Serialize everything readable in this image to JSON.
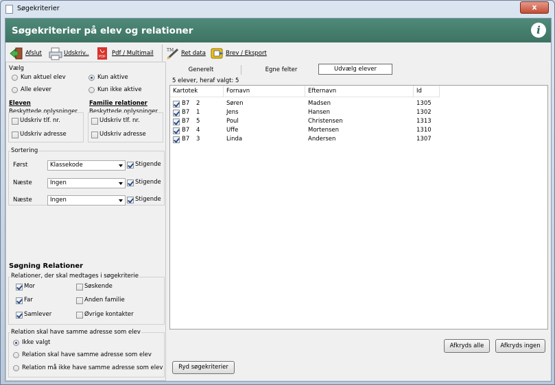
{
  "window": {
    "title": "Søgekriterier",
    "close_label": "x"
  },
  "header": {
    "title": "Søgekriterier på elev og relationer",
    "info_glyph": "i"
  },
  "toolbar": {
    "afslut": "Afslut",
    "udskriv": "Udskriv..",
    "pdf": "Pdf / Multimail",
    "ret_data": "Ret data",
    "brev": "Brev / Eksport"
  },
  "left": {
    "vaelg_label": "Vælg",
    "kun_aktuel": "Kun aktuel elev",
    "alle": "Alle elever",
    "kun_aktive": "Kun aktive",
    "kun_ikke_aktive": "Kun ikke aktive",
    "eleven_title": "Eleven",
    "familie_title": "Familie relationer",
    "beskyttede1": "Beskyttede oplysninger",
    "beskyttede2": "Beskyttede oplysninger",
    "udskriv_tlf1": "Udskriv tlf. nr.",
    "udskriv_adr1": "Udskriv adresse",
    "udskriv_tlf2": "Udskriv tlf. nr.",
    "udskriv_adr2": "Udskriv adresse",
    "sortering_label": "Sortering",
    "sort": [
      {
        "label": "Først",
        "value": "Klassekode",
        "check": "Stigende"
      },
      {
        "label": "Næste",
        "value": "Ingen",
        "check": "Stigende"
      },
      {
        "label": "Næste",
        "value": "Ingen",
        "check": "Stigende"
      }
    ],
    "soegning_title": "Søgning Relationer",
    "relationer_label": "Relationer, der skal medtages i søgekriterie",
    "mor": "Mor",
    "far": "Far",
    "samlever": "Samlever",
    "soeskende": "Søskende",
    "anden_familie": "Anden familie",
    "oevrige": "Øvrige kontakter",
    "adresse_label": "Relation skal have samme adresse som elev",
    "ikke_valgt": "Ikke valgt",
    "samme_adr": "Relation skal have samme adresse som elev",
    "ikke_samme_adr": "Relation må ikke have samme adresse som elev"
  },
  "tabs": [
    "Generelt",
    "Egne felter",
    "Udvælg elever"
  ],
  "summary": "5 elever, heraf valgt: 5",
  "columns": [
    "Kartotek",
    "Fornavn",
    "Efternavn",
    "Id"
  ],
  "rows": [
    {
      "kartotek": "B7",
      "nr": "2",
      "fornavn": "Søren",
      "efternavn": "Madsen",
      "id": "1305"
    },
    {
      "kartotek": "B7",
      "nr": "1",
      "fornavn": "Jens",
      "efternavn": "Hansen",
      "id": "1302"
    },
    {
      "kartotek": "B7",
      "nr": "5",
      "fornavn": "Poul",
      "efternavn": "Christensen",
      "id": "1313"
    },
    {
      "kartotek": "B7",
      "nr": "4",
      "fornavn": "Uffe",
      "efternavn": "Mortensen",
      "id": "1310"
    },
    {
      "kartotek": "B7",
      "nr": "3",
      "fornavn": "Linda",
      "efternavn": "Andersen",
      "id": "1307"
    }
  ],
  "buttons": {
    "afkryds_alle": "Afkryds alle",
    "afkryds_ingen": "Afkryds ingen",
    "ryd": "Ryd søgekriterier"
  }
}
